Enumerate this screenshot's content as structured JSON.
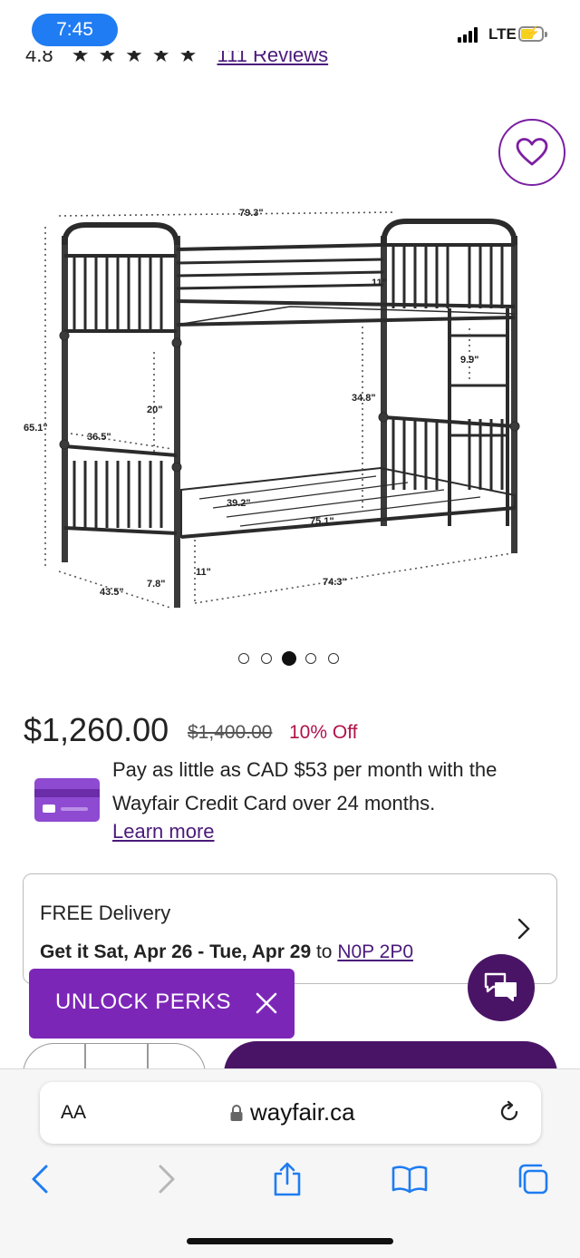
{
  "status_bar": {
    "time": "7:45",
    "network": "LTE"
  },
  "rating": {
    "score": "4.8",
    "stars": "★★★★★",
    "reviews": "111 Reviews"
  },
  "product": {
    "dimensions": {
      "width_top": "79.3\"",
      "rail_height": "11\"",
      "ladder_step": "9.9\"",
      "height_total": "65.1\"",
      "clearance": "20\"",
      "upper_depth": "36.5\"",
      "side_height": "34.8\"",
      "mattress_width": "39.2\"",
      "mattress_length": "75.1\"",
      "base_depth": "43.5\"",
      "leg_height": "7.8\"",
      "bottom_clearance": "11\"",
      "base_length": "74.3\""
    },
    "carousel": {
      "count": 5,
      "active_index": 2
    },
    "price": "$1,260.00",
    "original_price": "$1,400.00",
    "discount": "10% Off"
  },
  "credit": {
    "text": "Pay as little as CAD $53 per month with the Wayfair Credit Card over 24 months.",
    "learn_more": "Learn more"
  },
  "delivery": {
    "title": "FREE Delivery",
    "dates": "Get it Sat, Apr 26 - Tue, Apr 29",
    "to": "to",
    "zip": "N0P 2P0"
  },
  "promo": {
    "label": "UNLOCK PERKS"
  },
  "browser": {
    "aa": "AA",
    "url": "wayfair.ca"
  },
  "colors": {
    "brand_purple": "#7c26b8",
    "deep_purple": "#4a1466",
    "sale_red": "#b0124a",
    "safari_blue": "#1f7cf2"
  }
}
